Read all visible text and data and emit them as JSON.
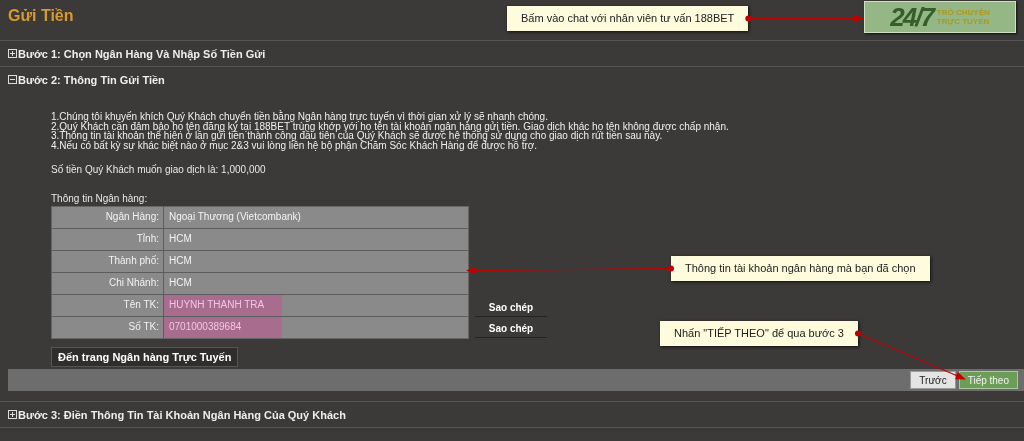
{
  "page_title": "Gửi Tiền",
  "chat_badge": {
    "big": "24/7",
    "line_1": "TRÒ CHUYỆN",
    "line_2": "TRỰC TUYẾN"
  },
  "steps": [
    {
      "title": "Bước 1: Chọn Ngân Hàng Và Nhập Số Tiền Gửi",
      "expanded": false
    },
    {
      "title": "Bước 2: Thông Tin Gửi Tiền",
      "expanded": true,
      "notes": [
        "1.Chúng tôi khuyến khích Quý Khách chuyển tiền bằng Ngân hàng trực tuyến vì thời gian xử lý sẽ nhanh chóng.",
        "2.Quý Khách cần đảm bảo họ tên đăng ký tại 188BET trùng khớp với họ tên tài khoản ngân hàng gửi tiền. Giao dịch khác họ tên không được chấp nhận.",
        "3.Thông tin tài khoản thể hiện ở lần gửi tiền thành công đầu tiên của Quý Khách sẽ được hệ thống sử dụng cho giao dịch rút tiền sau này.",
        "4.Nếu có bất kỳ sự khác biệt nào ở mục 2&3 vui lòng liên hệ bộ phận Chăm Sóc Khách Hàng để được hỗ trợ."
      ],
      "amount_text": "Số tiền Quý Khách muốn giao dịch là: 1,000,000",
      "bank_caption": "Thông tin Ngân hàng:",
      "bank_rows": [
        {
          "label": "Ngân Hàng:",
          "value": "Ngoại Thương (Vietcombank)",
          "highlighted": false
        },
        {
          "label": "Tỉnh:",
          "value": "HCM",
          "highlighted": false
        },
        {
          "label": "Thành phố:",
          "value": "HCM",
          "highlighted": false
        },
        {
          "label": "Chi Nhánh:",
          "value": "HCM",
          "highlighted": false
        },
        {
          "label": "Tên TK:",
          "value": "HUYNH THANH TRA",
          "highlighted": true,
          "copy_button": "Sao chép"
        },
        {
          "label": "Số TK:",
          "value": "0701000389684",
          "highlighted": true,
          "copy_button": "Sao chép"
        }
      ],
      "online_bank_button": "Đến trang Ngân hàng Trực Tuyến",
      "nav_buttons": [
        {
          "label": "Trước",
          "kind": "back"
        },
        {
          "label": "Tiếp theo",
          "kind": "next"
        }
      ]
    },
    {
      "title": "Bước 3: Điền Thông Tin Tài Khoản Ngân Hàng Của Quý Khách",
      "expanded": false
    }
  ],
  "annotations": [
    {
      "text": "Bấm vào chat với nhân viên tư vấn 188BET",
      "kind": "chat"
    },
    {
      "text": "Thông tin tài khoản ngân hàng mà bạn đã chọn",
      "kind": "table"
    },
    {
      "text": "Nhấn \"TIẾP THEO\" để qua bước 3",
      "kind": "next"
    }
  ]
}
